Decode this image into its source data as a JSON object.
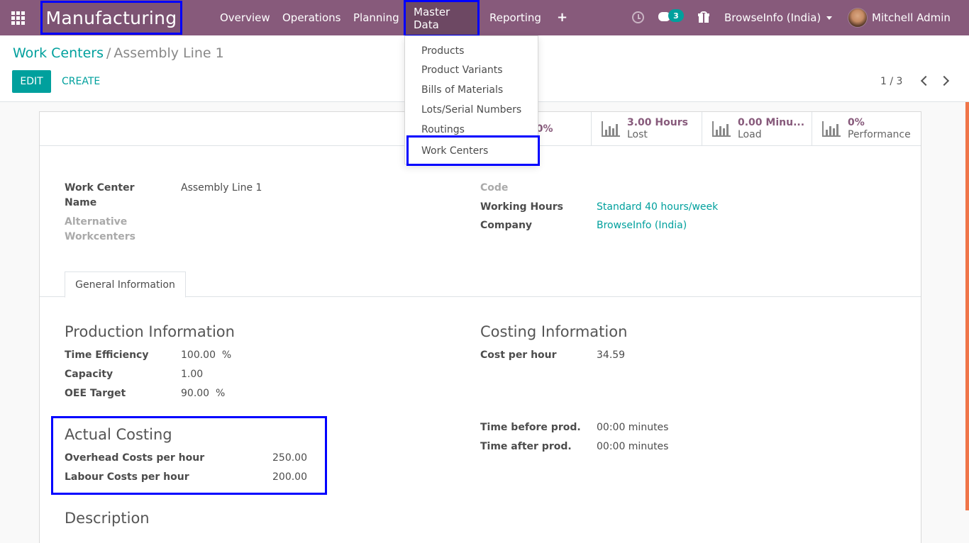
{
  "navbar": {
    "app_name": "Manufacturing",
    "menu": [
      "Overview",
      "Operations",
      "Planning",
      "Master Data",
      "Reporting"
    ],
    "plus": "+",
    "chat_badge": "3",
    "company": "BrowseInfo (India)",
    "user": "Mitchell Admin",
    "icons": [
      "apps-icon",
      "clock-icon",
      "chat-icon",
      "gift-icon"
    ]
  },
  "dropdown": {
    "items": [
      "Products",
      "Product Variants",
      "Bills of Materials",
      "Lots/Serial Numbers",
      "Routings",
      "Work Centers"
    ]
  },
  "breadcrumb": {
    "parent": "Work Centers",
    "separator": "/",
    "current": "Assembly Line 1"
  },
  "buttons": {
    "edit": "EDIT",
    "create": "CREATE"
  },
  "pager": {
    "value": "1 / 3"
  },
  "stats": [
    {
      "value": "00%",
      "label": ""
    },
    {
      "value": "3.00 Hours",
      "label": "Lost"
    },
    {
      "value": "0.00 Minu...",
      "label": "Load"
    },
    {
      "value": "0%",
      "label": "Performance"
    }
  ],
  "header_fields": {
    "work_center_name_label_1": "Work Center",
    "work_center_name_label_2": "Name",
    "work_center_name": "Assembly Line 1",
    "alt_label_1": "Alternative",
    "alt_label_2": "Workcenters",
    "code_label": "Code",
    "working_hours_label": "Working Hours",
    "working_hours": "Standard 40 hours/week",
    "company_label": "Company",
    "company": "BrowseInfo (India)"
  },
  "tab": {
    "label": "General Information"
  },
  "production": {
    "title": "Production Information",
    "time_efficiency_label": "Time Efficiency",
    "time_efficiency": "100.00",
    "time_efficiency_unit": "%",
    "capacity_label": "Capacity",
    "capacity": "1.00",
    "oee_label": "OEE Target",
    "oee": "90.00",
    "oee_unit": "%"
  },
  "costing": {
    "title": "Costing Information",
    "cost_per_hour_label": "Cost per hour",
    "cost_per_hour": "34.59",
    "time_before_label": "Time before prod.",
    "time_before": "00:00 minutes",
    "time_after_label": "Time after prod.",
    "time_after": "00:00 minutes"
  },
  "actual_costing": {
    "title": "Actual Costing",
    "overhead_label": "Overhead Costs per hour",
    "overhead": "250.00",
    "labour_label": "Labour Costs per hour",
    "labour": "200.00"
  },
  "description": {
    "title": "Description"
  },
  "colors": {
    "brand": "#875a7b",
    "accent": "#00a09d",
    "highlight": "#0000ff"
  }
}
